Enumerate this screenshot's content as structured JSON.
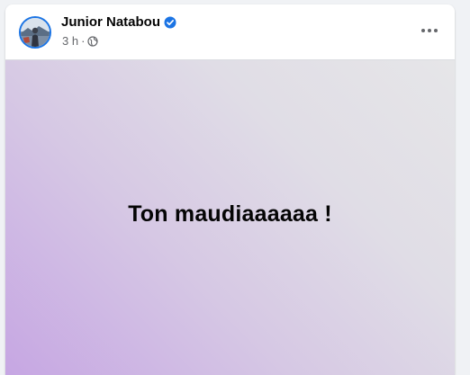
{
  "post": {
    "author": {
      "name": "Junior Natabou",
      "verified_icon": "verified-badge-icon",
      "avatar_icon": "profile-photo"
    },
    "meta": {
      "time": "3 h",
      "separator": "·",
      "audience_icon": "globe-icon"
    },
    "menu_icon": "more-options-icon",
    "text": "Ton maudiaaaaaa !",
    "colors": {
      "verified": "#1b74e4",
      "meta_text": "#65676b",
      "name_text": "#050505",
      "background_gradient": [
        "#c6a6e3",
        "#d6c8e4",
        "#e0dde6",
        "#e6e6e8"
      ]
    }
  }
}
